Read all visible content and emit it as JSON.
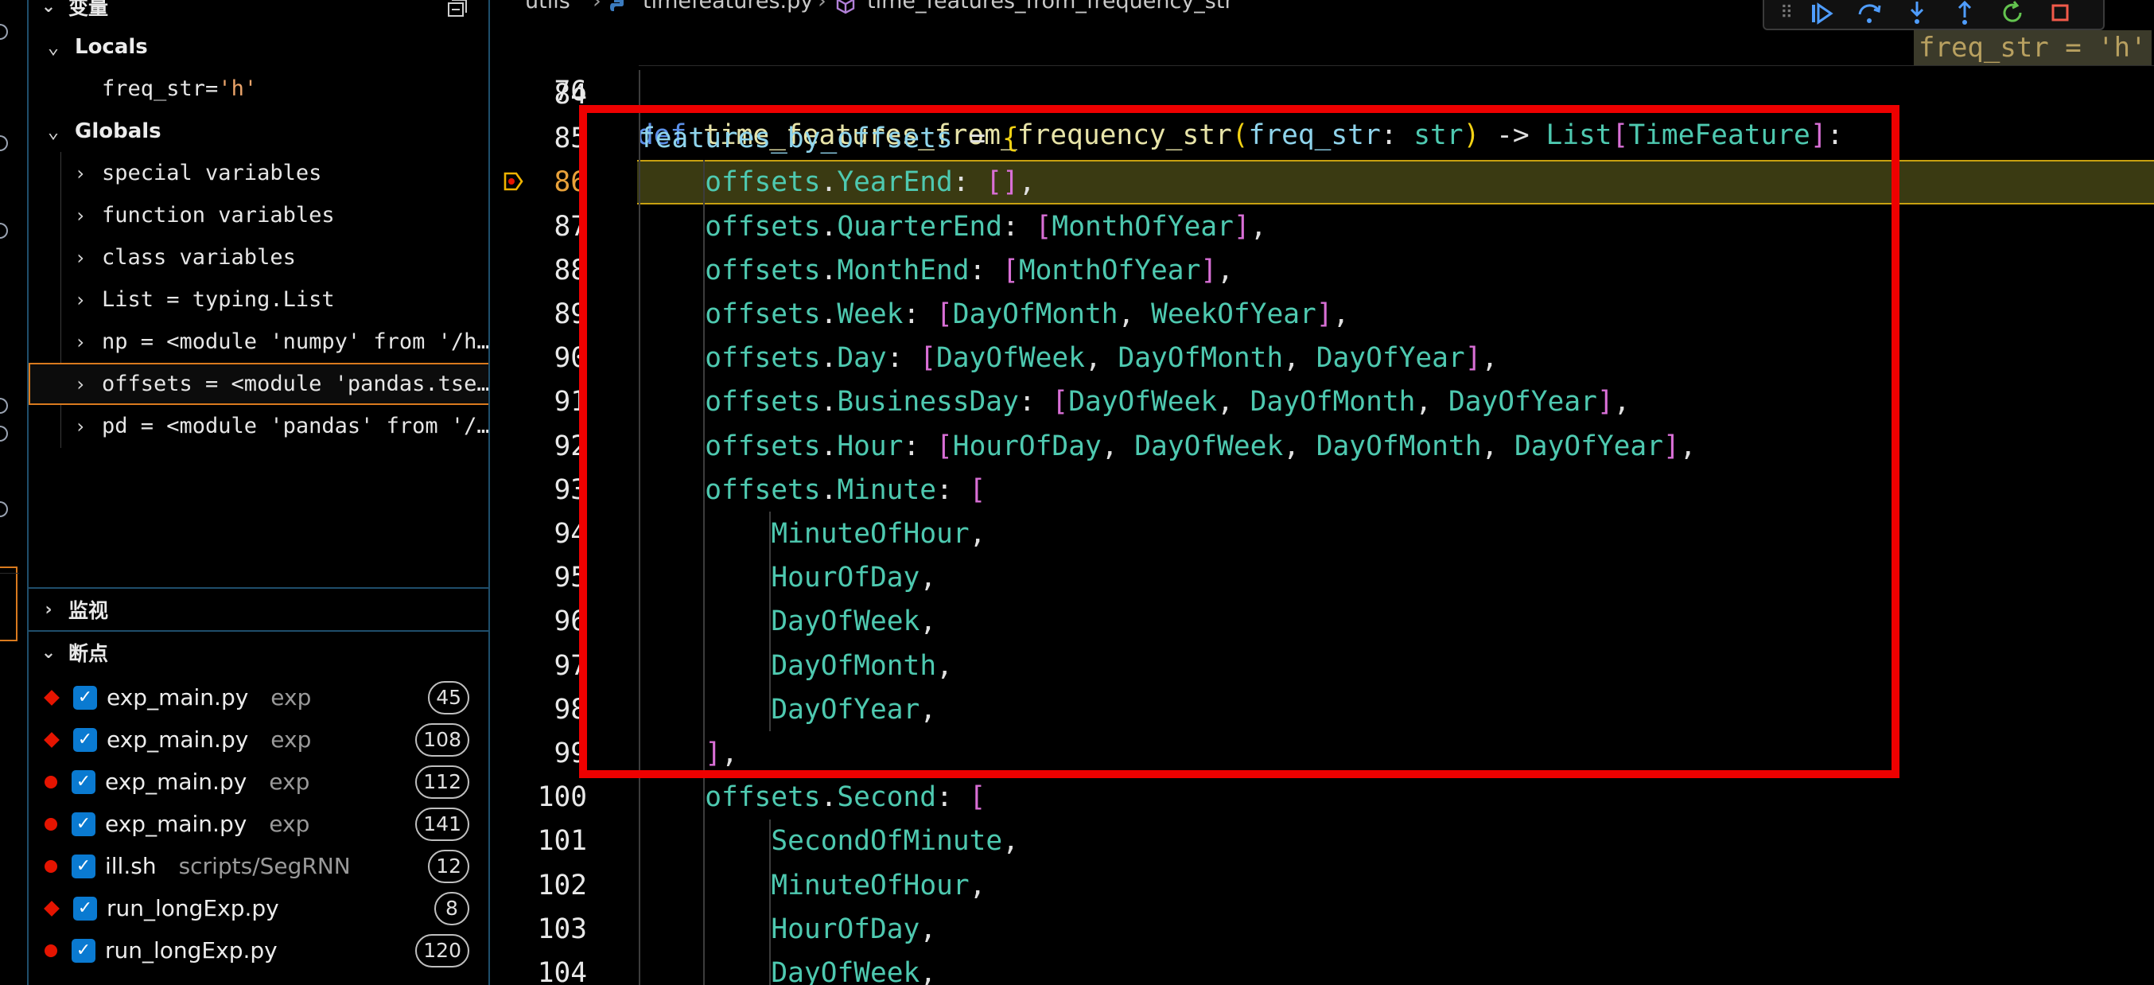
{
  "sidebar": {
    "variables_header": "变量",
    "locals_label": "Locals",
    "locals": [
      {
        "name": "freq_str",
        "value": "'h'"
      }
    ],
    "globals_label": "Globals",
    "globals": [
      "special variables",
      "function variables",
      "class variables",
      "List = typing.List",
      "np = <module 'numpy' from '/h…",
      "offsets = <module 'pandas.tse…",
      "pd = <module 'pandas' from '/…"
    ],
    "watch_header": "监视",
    "breakpoints_header": "断点",
    "breakpoints": [
      {
        "file": "exp_main.py",
        "dir": "exp",
        "line": "45",
        "shape": "diamond"
      },
      {
        "file": "exp_main.py",
        "dir": "exp",
        "line": "108",
        "shape": "diamond"
      },
      {
        "file": "exp_main.py",
        "dir": "exp",
        "line": "112",
        "shape": "circle"
      },
      {
        "file": "exp_main.py",
        "dir": "exp",
        "line": "141",
        "shape": "circle"
      },
      {
        "file": "ill.sh",
        "dir": "scripts/SegRNN",
        "line": "12",
        "shape": "circle"
      },
      {
        "file": "run_longExp.py",
        "dir": "",
        "line": "8",
        "shape": "diamond"
      },
      {
        "file": "run_longExp.py",
        "dir": "",
        "line": "120",
        "shape": "circle"
      }
    ]
  },
  "breadcrumb": {
    "folder": "utils",
    "file": "timefeatures.py",
    "symbol": "time_features_from_frequency_str"
  },
  "editor": {
    "sticky_line_number": "76",
    "sticky_code": {
      "kw": "def",
      "fn": "time_features_from_frequency_str",
      "param": "freq_str",
      "param_type": "str",
      "ret_type": "List",
      "ret_inner": "TimeFeature"
    },
    "inline_value": "freq_str = 'h'",
    "line_numbers": [
      "84",
      "85",
      "86",
      "87",
      "88",
      "89",
      "90",
      "91",
      "92",
      "93",
      "94",
      "95",
      "96",
      "97",
      "98",
      "99",
      "100",
      "101",
      "102",
      "103",
      "104"
    ],
    "dict_var": "features_by_offsets",
    "module": "offsets",
    "entries": [
      {
        "key": "YearEnd",
        "values": []
      },
      {
        "key": "QuarterEnd",
        "values": [
          "MonthOfYear"
        ]
      },
      {
        "key": "MonthEnd",
        "values": [
          "MonthOfYear"
        ]
      },
      {
        "key": "Week",
        "values": [
          "DayOfMonth",
          "WeekOfYear"
        ]
      },
      {
        "key": "Day",
        "values": [
          "DayOfWeek",
          "DayOfMonth",
          "DayOfYear"
        ]
      },
      {
        "key": "BusinessDay",
        "values": [
          "DayOfWeek",
          "DayOfMonth",
          "DayOfYear"
        ]
      },
      {
        "key": "Hour",
        "values": [
          "HourOfDay",
          "DayOfWeek",
          "DayOfMonth",
          "DayOfYear"
        ]
      }
    ],
    "minute_key": "Minute",
    "minute_values": [
      "MinuteOfHour",
      "HourOfDay",
      "DayOfWeek",
      "DayOfMonth",
      "DayOfYear"
    ],
    "second_key": "Second",
    "second_values": [
      "SecondOfMinute",
      "MinuteOfHour",
      "HourOfDay",
      "DayOfWeek"
    ]
  },
  "colors": {
    "annotation": "#ee0000",
    "current_line": "#3a3a12",
    "breakpoint": "#e51400",
    "checkbox": "#0a7ad1"
  }
}
